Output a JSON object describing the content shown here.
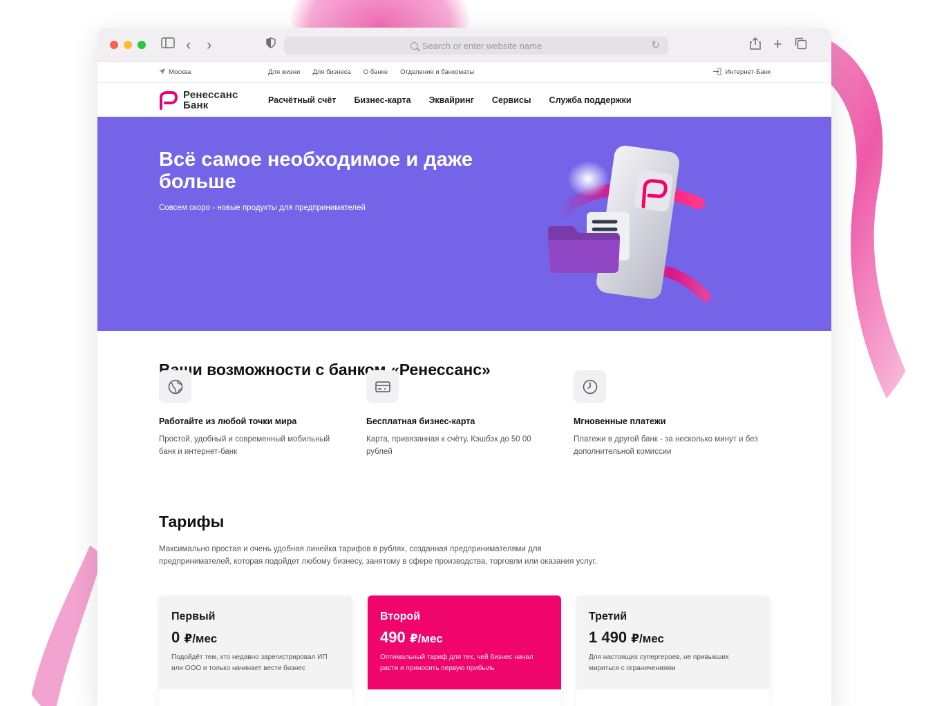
{
  "browser": {
    "url_placeholder": "Search or enter website name"
  },
  "utilbar": {
    "city": "Москва",
    "links": [
      "Для жизни",
      "Для бизнеса",
      "О банке",
      "Отделения и банкоматы"
    ],
    "internet_bank": "Интернет-Банк"
  },
  "header": {
    "logo_line1": "Ренессанс",
    "logo_line2": "Банк",
    "nav": [
      "Расчётный счёт",
      "Бизнес-карта",
      "Эквайринг",
      "Сервисы",
      "Служба поддержки"
    ]
  },
  "hero": {
    "title": "Всё самое необходимое и даже больше",
    "subtitle": "Совсем скоро - новые продукты для предпринимателей"
  },
  "features": {
    "title": "Ваши возможности с банком «Ренессанс»",
    "items": [
      {
        "icon": "globe-icon",
        "title": "Работайте из любой точки мира",
        "text": "Простой, удобный и современный мобильный банк и интернет-банк"
      },
      {
        "icon": "card-icon",
        "title": "Бесплатная бизнес-карта",
        "text": "Карта, привязанная к счёту. Кэшбэк до 50 00 рублей"
      },
      {
        "icon": "clock-icon",
        "title": "Мгновенные платежи",
        "text": "Платежи в другой банк - за несколько минут и без дополнительной комиссии"
      }
    ]
  },
  "tariffs": {
    "title": "Тарифы",
    "description": "Максимально простая и очень удобная линейка тарифов в рублях, созданная предпринимателями для предпринимателей, которая подойдет любому бизнесу, занятому в сфере производства, торговли или оказания услуг.",
    "cards": [
      {
        "name": "Первый",
        "price": "0",
        "unit": "₽/мес",
        "desc": "Подойдёт тем, кто недавно зарегистрировал ИП или ООО и только начинает вести бизнес"
      },
      {
        "name": "Второй",
        "price": "490",
        "unit": "₽/мес",
        "desc": "Оптимальный тариф для тех, чей бизнес начал расти и приносить первую прибыль"
      },
      {
        "name": "Третий",
        "price": "1 490",
        "unit": "₽/мес",
        "desc": "Для настоящих супергероев, не привыкших мириться с ограничениями"
      }
    ]
  },
  "colors": {
    "hero_bg": "#7563e8",
    "brand_pink": "#f0056d"
  }
}
